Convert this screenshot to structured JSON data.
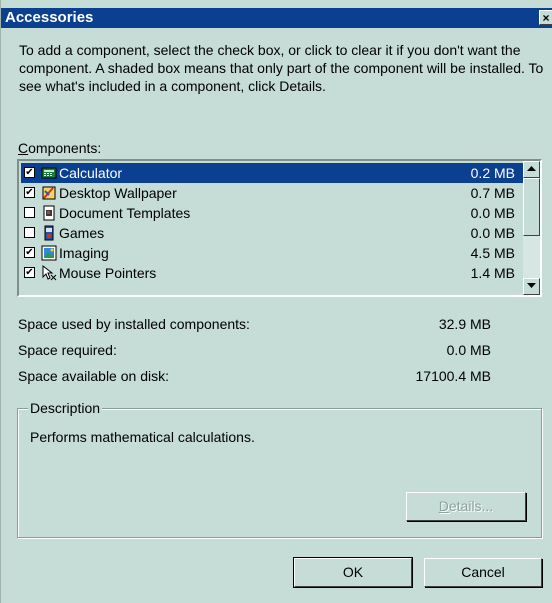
{
  "window": {
    "title": "Accessories",
    "close_symbol": "×"
  },
  "intro_text": "To add a component, select the check box, or click to clear it if you don't want the component. A shaded box means that only part of the component will be installed. To see what's included in a component, click Details.",
  "components_label": {
    "accel": "C",
    "rest": "omponents:"
  },
  "components": [
    {
      "label": "Calculator",
      "size": "0.2 MB",
      "checked": true,
      "selected": true,
      "icon": "calculator-icon"
    },
    {
      "label": "Desktop Wallpaper",
      "size": "0.7 MB",
      "checked": true,
      "selected": false,
      "icon": "wallpaper-icon"
    },
    {
      "label": "Document Templates",
      "size": "0.0 MB",
      "checked": false,
      "selected": false,
      "icon": "document-templates-icon"
    },
    {
      "label": "Games",
      "size": "0.0 MB",
      "checked": false,
      "selected": false,
      "icon": "games-icon"
    },
    {
      "label": "Imaging",
      "size": "4.5 MB",
      "checked": true,
      "selected": false,
      "icon": "imaging-icon"
    },
    {
      "label": "Mouse Pointers",
      "size": "1.4 MB",
      "checked": true,
      "selected": false,
      "icon": "mouse-pointers-icon"
    }
  ],
  "check_glyph": "✔",
  "space": {
    "used_label": "Space used by installed components:",
    "used_value": "32.9 MB",
    "required_label": "Space required:",
    "required_value": "0.0 MB",
    "available_label": "Space available on disk:",
    "available_value": "17100.4 MB"
  },
  "description": {
    "title": "Description",
    "text": "Performs mathematical calculations."
  },
  "buttons": {
    "details_accel": "D",
    "details_rest": "etails...",
    "ok": "OK",
    "cancel": "Cancel"
  },
  "colors": {
    "titlebar": "#0b3f90",
    "dialog_bg": "#c6dcd6",
    "selection": "#0b3f90"
  }
}
